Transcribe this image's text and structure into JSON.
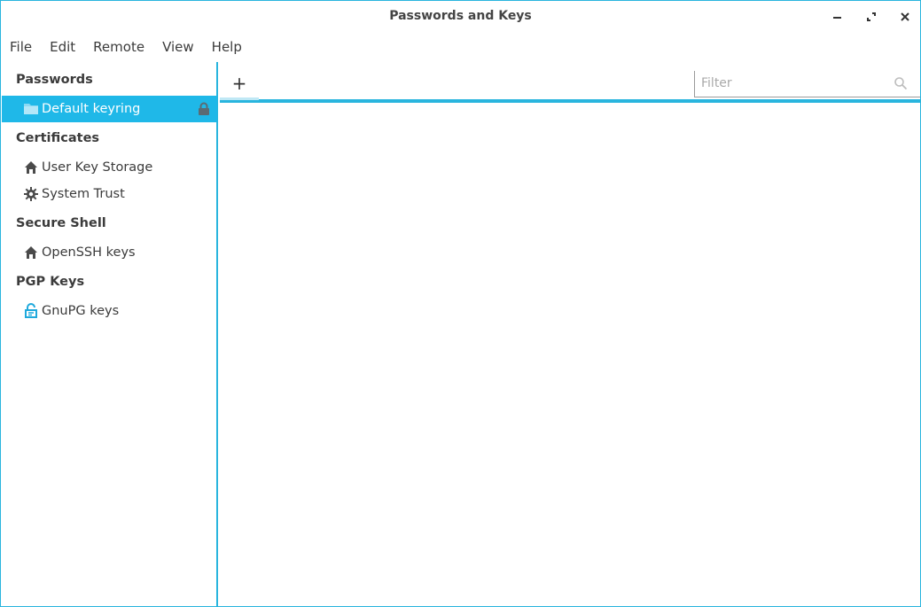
{
  "window": {
    "title": "Passwords and Keys"
  },
  "menu": [
    "File",
    "Edit",
    "Remote",
    "View",
    "Help"
  ],
  "sidebar": {
    "sections": [
      {
        "header": "Passwords",
        "items": [
          {
            "label": "Default keyring",
            "icon": "folder-icon",
            "selected": true,
            "locked": true
          }
        ]
      },
      {
        "header": "Certificates",
        "items": [
          {
            "label": "User Key Storage",
            "icon": "home-icon"
          },
          {
            "label": "System Trust",
            "icon": "gear-icon"
          }
        ]
      },
      {
        "header": "Secure Shell",
        "items": [
          {
            "label": "OpenSSH keys",
            "icon": "home-icon"
          }
        ]
      },
      {
        "header": "PGP Keys",
        "items": [
          {
            "label": "GnuPG keys",
            "icon": "gnupg-icon"
          }
        ]
      }
    ]
  },
  "toolbar": {
    "add_label": "+",
    "filter_placeholder": "Filter"
  },
  "colors": {
    "accent": "#29b5de",
    "selection": "#1fb8e8",
    "text": "#3b3b3b"
  }
}
